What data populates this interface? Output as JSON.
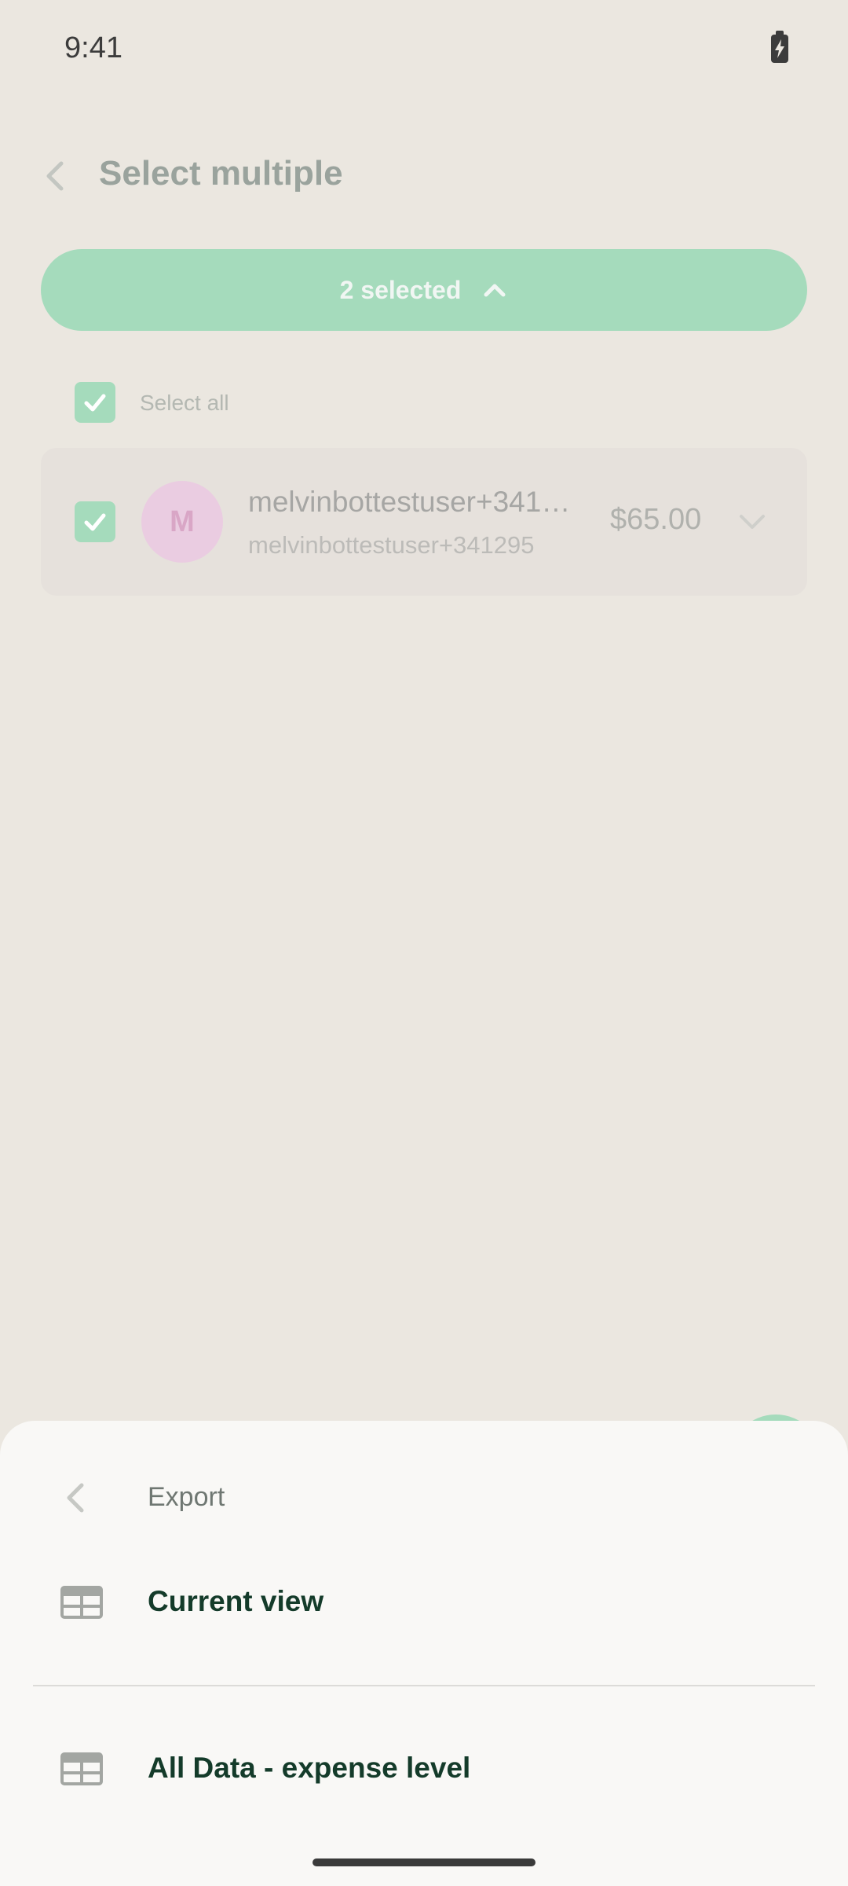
{
  "status_bar": {
    "time": "9:41"
  },
  "header": {
    "title": "Select multiple"
  },
  "selection": {
    "label": "2 selected"
  },
  "select_all": {
    "label": "Select all",
    "checked": true
  },
  "rows": [
    {
      "avatar_initial": "M",
      "title": "melvinbottestuser+341295",
      "subtitle": "melvinbottestuser+341295",
      "amount": "$65.00",
      "checked": true
    }
  ],
  "sheet": {
    "title": "Export",
    "options": [
      {
        "label": "Current view",
        "icon": "table-icon"
      },
      {
        "label": "All Data - expense level",
        "icon": "table-icon"
      }
    ]
  },
  "colors": {
    "accent": "#a5dbbc",
    "sheet_bg": "#f9f8f6",
    "text_dark": "#143b2a"
  }
}
